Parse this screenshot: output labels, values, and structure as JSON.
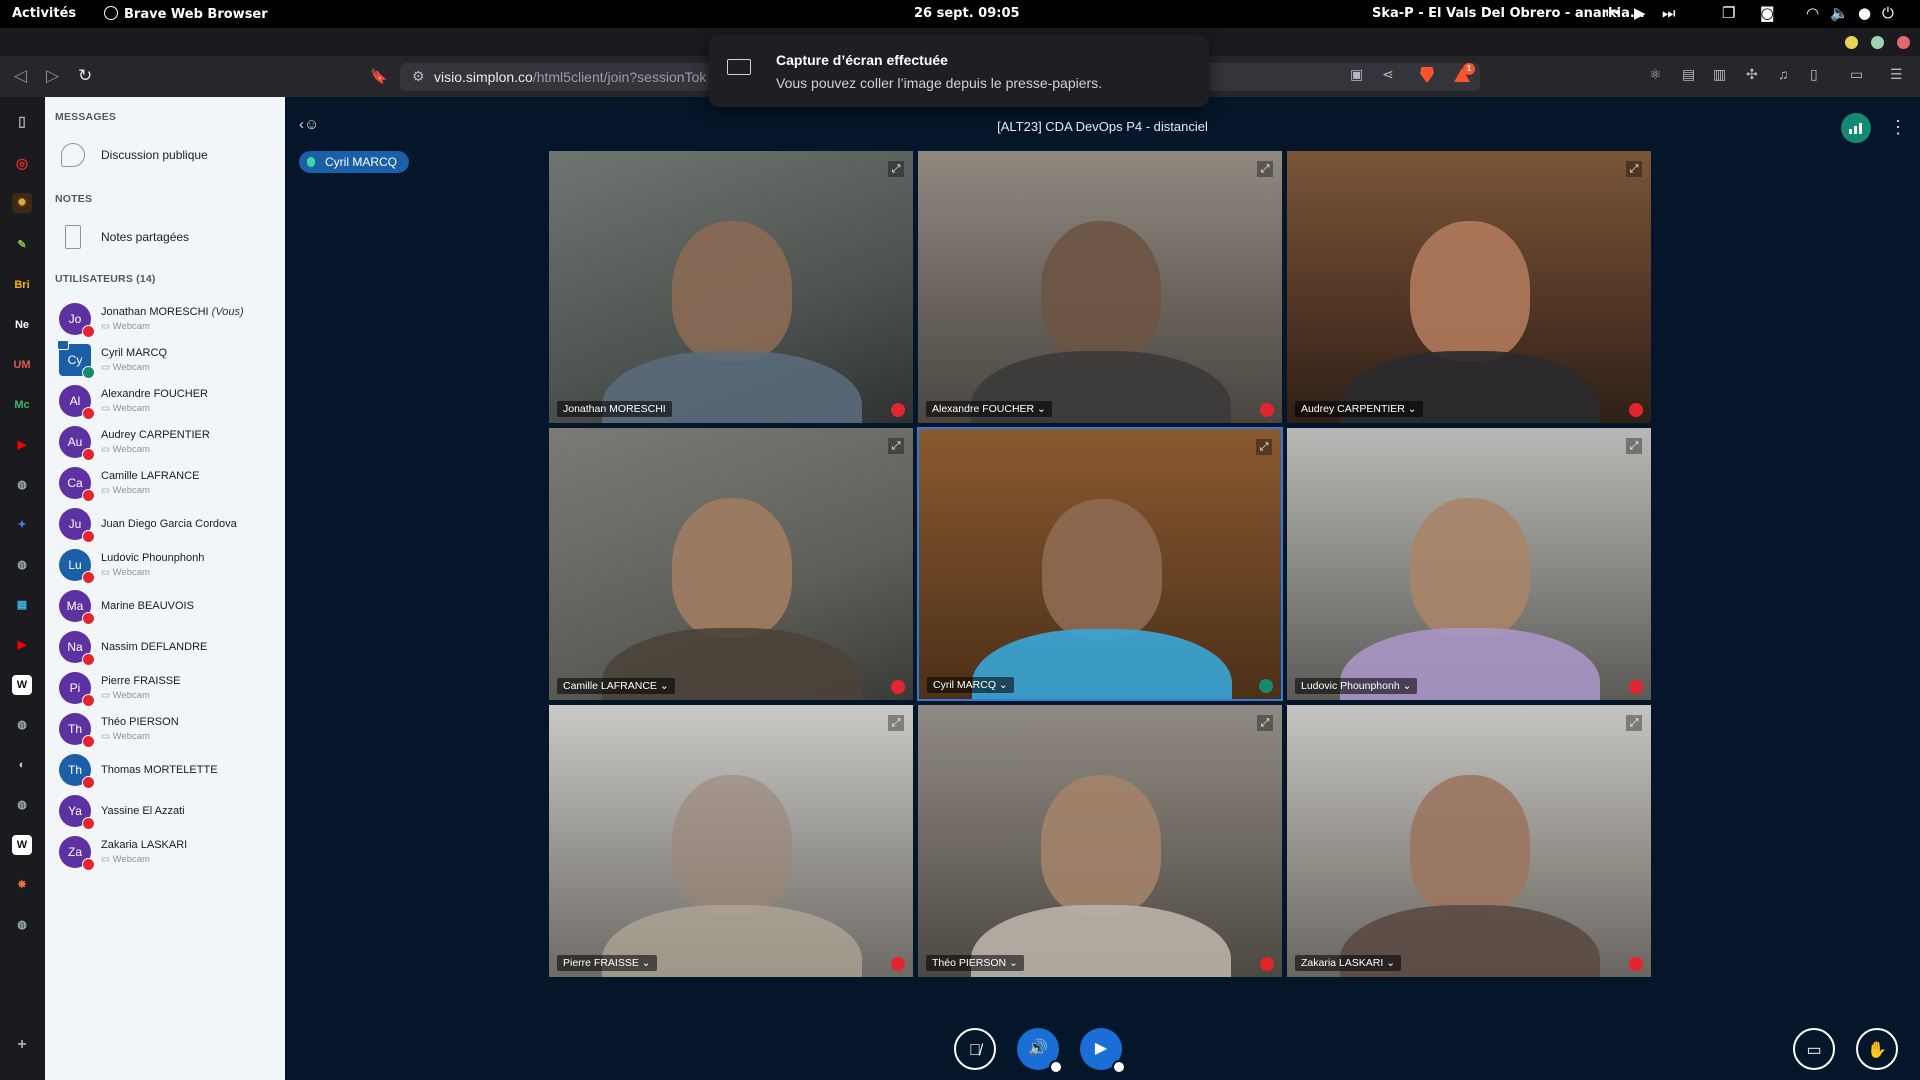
{
  "topbar": {
    "activities": "Activités",
    "app_name": "Brave Web Browser",
    "clock": "26 sept.  09:05",
    "media_title": "Ska-P - El Vals Del Obrero - anarkia..."
  },
  "browser": {
    "url_main": "visio.simplon.co",
    "url_path": "/html5client/join?sessionTok",
    "brave_badge": "1",
    "sidebar_labels": [
      "Bri",
      "Ne",
      "UM",
      "Mc"
    ]
  },
  "toast": {
    "title": "Capture d’écran effectuée",
    "message": "Vous pouvez coller l’image depuis le presse-papiers."
  },
  "meeting": {
    "title": "[ALT23] CDA DevOps P4 - distanciel",
    "talking": "Cyril MARCQ"
  },
  "panel": {
    "messages_heading": "MESSAGES",
    "public_chat": "Discussion publique",
    "notes_heading": "NOTES",
    "shared_notes": "Notes partagées",
    "users_heading": "UTILISATEURS (14)",
    "webcam_label": "Webcam",
    "you_label": "(Vous)",
    "users": [
      {
        "initials": "Jo",
        "name": "Jonathan MORESCHI",
        "webcam": true,
        "you": true
      },
      {
        "initials": "Cy",
        "name": "Cyril MARCQ",
        "webcam": true,
        "presenter": true
      },
      {
        "initials": "Al",
        "name": "Alexandre FOUCHER",
        "webcam": true
      },
      {
        "initials": "Au",
        "name": "Audrey CARPENTIER",
        "webcam": true
      },
      {
        "initials": "Ca",
        "name": "Camille LAFRANCE",
        "webcam": true
      },
      {
        "initials": "Ju",
        "name": "Juan Diego Garcia Cordova",
        "webcam": false
      },
      {
        "initials": "Lu",
        "name": "Ludovic Phounphonh",
        "webcam": true
      },
      {
        "initials": "Ma",
        "name": "Marine BEAUVOIS",
        "webcam": false
      },
      {
        "initials": "Na",
        "name": "Nassim DEFLANDRE",
        "webcam": false
      },
      {
        "initials": "Pi",
        "name": "Pierre FRAISSE",
        "webcam": true
      },
      {
        "initials": "Th",
        "name": "Théo PIERSON",
        "webcam": true
      },
      {
        "initials": "Th",
        "name": "Thomas MORTELETTE",
        "webcam": false
      },
      {
        "initials": "Ya",
        "name": "Yassine El Azzati",
        "webcam": false
      },
      {
        "initials": "Za",
        "name": "Zakaria LASKARI",
        "webcam": true
      }
    ]
  },
  "videos": [
    {
      "name": "Jonathan MORESCHI"
    },
    {
      "name": "Alexandre FOUCHER ⌄"
    },
    {
      "name": "Audrey CARPENTIER ⌄"
    },
    {
      "name": "Camille LAFRANCE ⌄"
    },
    {
      "name": "Cyril MARCQ ⌄"
    },
    {
      "name": "Ludovic Phounphonh ⌄"
    },
    {
      "name": "Pierre FRAISSE ⌄"
    },
    {
      "name": "Théo PIERSON ⌄"
    },
    {
      "name": "Zakaria LASKARI ⌄"
    }
  ],
  "colors": {
    "main_bg": "#05162b",
    "accent_blue": "#1a6fd6",
    "mute_red": "#e2252f",
    "talk_green": "#168a6f",
    "avatar_purple": "#5e31a3"
  }
}
